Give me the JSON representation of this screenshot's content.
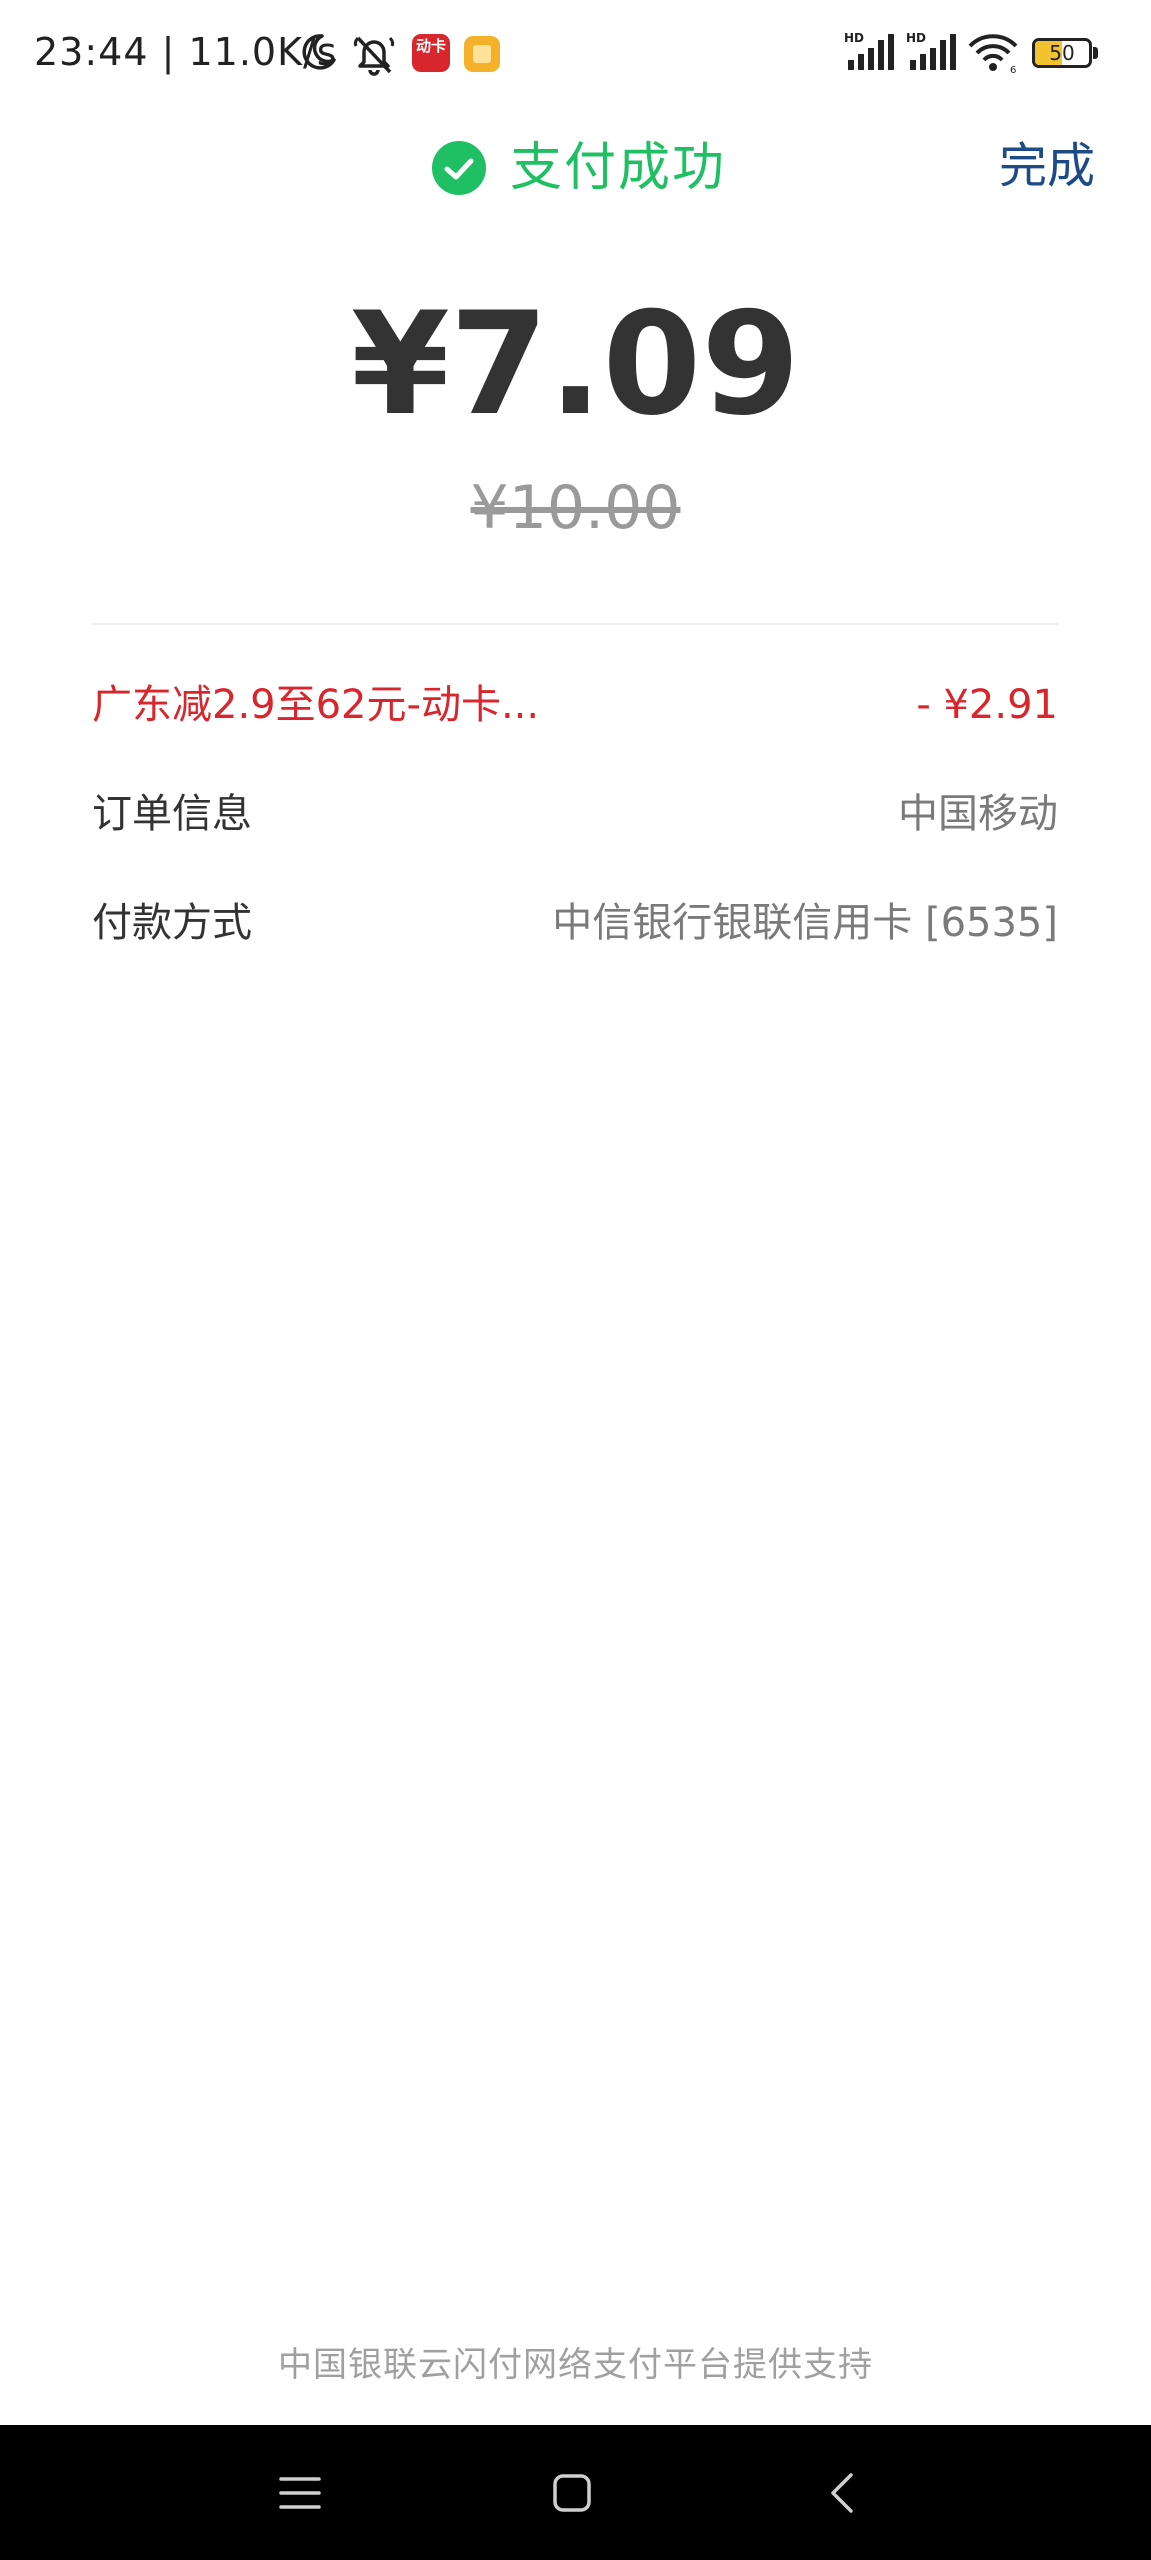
{
  "status_bar": {
    "time_speed": "23:44 | 11.0K/s",
    "app_badge_text": "动卡",
    "battery_level": "50",
    "battery_fraction": 0.5,
    "icons": [
      "moon-icon",
      "mute-icon",
      "app-icon-red",
      "app-icon-orange",
      "hd-signal-icon",
      "hd-signal-icon",
      "wifi-icon",
      "battery-icon"
    ]
  },
  "header": {
    "status_text": "支付成功",
    "done_label": "完成",
    "status_color": "#1fbf63",
    "done_color": "#1c4b86"
  },
  "payment": {
    "amount": "¥7.09",
    "original_amount": "¥10.00"
  },
  "details": {
    "discount": {
      "label": "广东减2.9至62元-动卡...",
      "value": "- ¥2.91",
      "color": "#d9252c"
    },
    "order": {
      "label": "订单信息",
      "value": "中国移动"
    },
    "payment_method": {
      "label": "付款方式",
      "value": "中信银行银联信用卡 [6535]"
    }
  },
  "footer": {
    "note": "中国银联云闪付网络支付平台提供支持"
  },
  "nav_bar": {
    "icons": [
      "menu-icon",
      "home-icon",
      "back-icon"
    ]
  }
}
